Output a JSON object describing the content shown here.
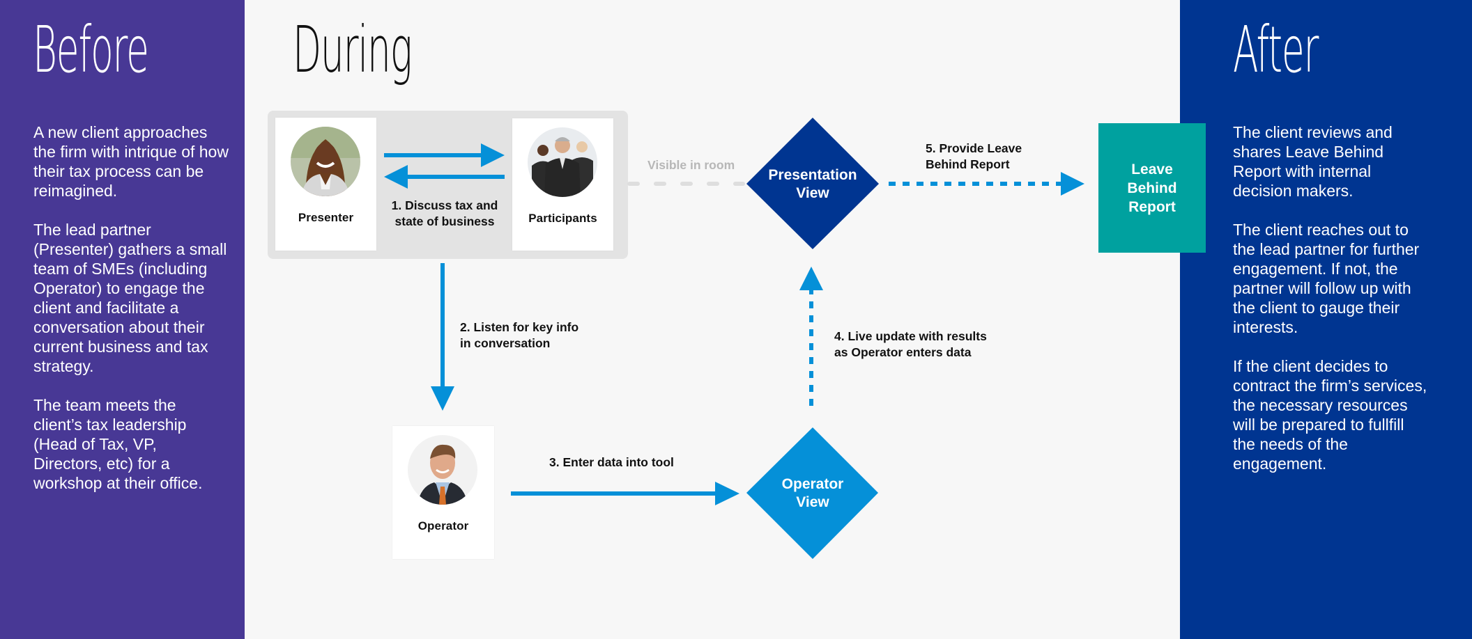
{
  "colors": {
    "before_panel": "#483895",
    "during_panel": "#f7f7f7",
    "after_panel": "#003591",
    "arrow_blue": "#0590d8",
    "presentation_view": "#003591",
    "operator_view": "#0590d8",
    "leave_behind": "#00a19f",
    "visible_line": "#dedede"
  },
  "before": {
    "heading": "Before",
    "paragraphs": [
      "A new client approaches the firm with intrique of how their tax process can be reimagined.",
      "The lead partner (Presenter) gathers a small team of SMEs (including Operator) to engage the client and facilitate a conversation about their current business and tax strategy.",
      "The team meets the client’s tax leadership (Head of Tax, VP, Directors, etc) for a workshop at their office."
    ]
  },
  "during": {
    "heading": "During",
    "actors": {
      "presenter": {
        "label": "Presenter",
        "icon": "presenter-photo"
      },
      "participants": {
        "label": "Participants",
        "icon": "participants-photo"
      },
      "operator": {
        "label": "Operator",
        "icon": "operator-photo"
      }
    },
    "steps": {
      "step1": "1. Discuss tax and state of business",
      "step2_line1": "2. Listen for key info",
      "step2_line2": "in conversation",
      "step3": "3. Enter data into tool",
      "step4_line1": "4. Live update with results",
      "step4_line2": "as Operator enters data",
      "step5_line1": "5. Provide Leave",
      "step5_line2": "Behind Report"
    },
    "visible_in_room": "Visible in room",
    "presentation_view": {
      "line1": "Presentation",
      "line2": "View"
    },
    "operator_view": {
      "line1": "Operator",
      "line2": "View"
    },
    "leave_behind_report": "Leave\nBehind\nReport"
  },
  "after": {
    "heading": "After",
    "paragraphs": [
      "The client reviews and shares Leave Behind Report with internal decision makers.",
      "The client reaches out to the lead partner for further engagement. If not, the partner will follow up with the client to gauge their interests.",
      "If the client decides to contract the firm’s services, the necessary resources will be prepared to fullfill the needs of the engagement."
    ]
  }
}
